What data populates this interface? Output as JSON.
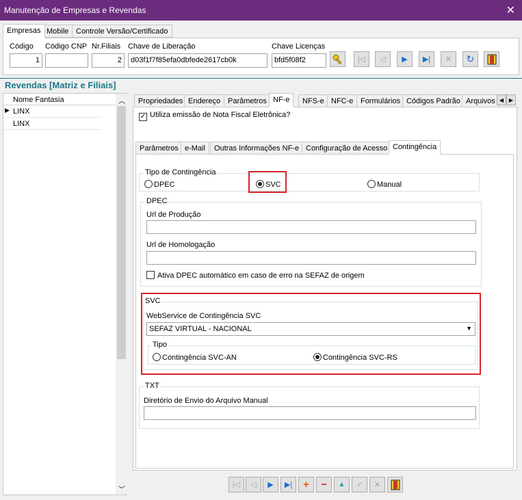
{
  "window": {
    "title": "Manutenção de Empresas e Revendas",
    "close": "✕"
  },
  "top_tabs": [
    "Empresas",
    "Mobile",
    "Controle Versão/Certificado"
  ],
  "header": {
    "codigo_label": "Código",
    "codigo_value": "1",
    "codigo_cnp_label": "Código CNP",
    "codigo_cnp_value": "",
    "nr_filiais_label": "Nr.Filiais",
    "nr_filiais_value": "2",
    "chave_liberacao_label": "Chave de Liberação",
    "chave_liberacao_value": "d03f1f7f85efa0dbfede2617cb0k",
    "chave_licencas_label": "Chave Licenças",
    "chave_licencas_value": "bfd5f08f2"
  },
  "revendas": {
    "title": "Revendas [Matriz e Filiais]",
    "column": "Nome Fantasia",
    "rows": [
      "LINX",
      "LINX"
    ]
  },
  "main_tabs": [
    "Propriedades",
    "Endereço",
    "Parâmetros",
    "NF-e",
    "NFS-e",
    "NFC-e",
    "Formulários",
    "Códigos Padrão",
    "Arquivos"
  ],
  "nfe_checkbox_label": "Utiliza emissão de Nota Fiscal Eletrônica?",
  "sub_tabs": [
    "Parâmetros",
    "e-Mail",
    "Outras Informações NF-e",
    "Configuração de Acesso",
    "Contingência"
  ],
  "contingencia": {
    "tipo_label": "Tipo de Contingência",
    "options": [
      "DPEC",
      "SVC",
      "Manual"
    ],
    "selected": "SVC"
  },
  "dpec": {
    "title": "DPEC",
    "url_producao_label": "Url de Produção",
    "url_producao_value": "",
    "url_homologacao_label": "Url de Homologação",
    "url_homologacao_value": "",
    "ativa_label": "Ativa DPEC automático em caso de erro na SEFAZ de origem"
  },
  "svc": {
    "title": "SVC",
    "webservice_label": "WebService de Contingência SVC",
    "webservice_value": "SEFAZ VIRTUAL - NACIONAL",
    "tipo_label": "Tipo",
    "options": [
      "Contingência SVC-AN",
      "Contingência SVC-RS"
    ],
    "selected": "Contingência SVC-RS"
  },
  "txt": {
    "title": "TXT",
    "diretorio_label": "Diretório de Envio do Arquivo Manual",
    "diretorio_value": ""
  },
  "nav_glyphs": {
    "first": "|◁",
    "prev": "◁",
    "next": "▶",
    "last": "▶|",
    "cancel": "✕",
    "refresh": "↻",
    "add": "+",
    "remove": "−",
    "up": "▲",
    "ok": "✓"
  },
  "colors": {
    "titlebar": "#6b2c7d",
    "accent_blue": "#1c6ed1",
    "section_title": "#1a7a8a",
    "highlight_red": "#d8232a"
  }
}
